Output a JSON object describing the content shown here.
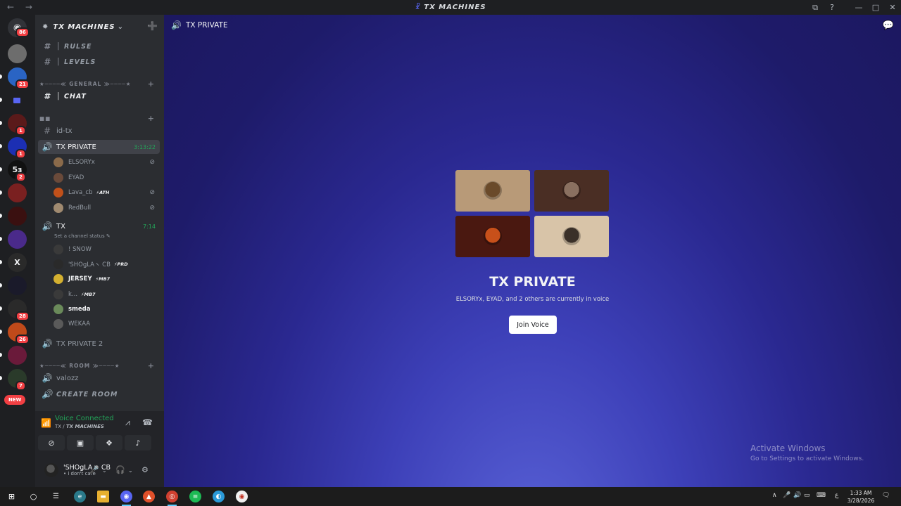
{
  "window": {
    "title": "TX MACHINES",
    "nav": "← →",
    "controls": [
      "⧉",
      "?",
      "—",
      "□",
      "✕"
    ]
  },
  "rail": {
    "home_badge": "86",
    "servers": [
      {
        "badge": "",
        "color": "#6d6d6d"
      },
      {
        "badge": "21",
        "color": "#2a64c4"
      },
      {
        "badge": "",
        "color": "#5865f2",
        "folder": true
      },
      {
        "badge": "1",
        "color": "#5a1a1a"
      },
      {
        "badge": "1",
        "color": "#1c2fb3"
      },
      {
        "badge": "2",
        "color": "#111111",
        "label": "5з"
      },
      {
        "badge": "",
        "color": "#7a2020"
      },
      {
        "badge": "",
        "color": "#3a1010"
      },
      {
        "badge": "",
        "color": "#4a2a8a"
      },
      {
        "badge": "",
        "color": "#2a2a2a",
        "label": "X"
      },
      {
        "badge": "",
        "color": "#1a1a2a"
      },
      {
        "badge": "28",
        "color": "#2a2a2a"
      },
      {
        "badge": "26",
        "color": "#c04a1a"
      },
      {
        "badge": "",
        "color": "#6a1a3a"
      },
      {
        "badge": "7",
        "color": "#2a3a2a"
      }
    ],
    "new_label": "NEW"
  },
  "sidebar": {
    "guild_name": "TX MACHINES",
    "channels": {
      "rulse": "│ RULSE",
      "levels": "│ LEVELS",
      "chat": "│ CHAT",
      "id_tx": "id-tx",
      "tx_private": "TX PRIVATE",
      "tx_private_time": "3:13:22",
      "tx": "TX",
      "tx_time": "7:14",
      "tx_status": "Set a channel status",
      "tx_private_2": "TX PRIVATE 2",
      "valozz": "valozz",
      "create_room": "CREATE ROOM"
    },
    "categories": {
      "general": "★────≪ GENERAL ≫────★",
      "unnamed": "■■",
      "room": "★────≪ ROOM ≫────★"
    },
    "private_members": [
      {
        "name": "ELSORYx",
        "tag": "",
        "color": "#8a6a4a"
      },
      {
        "name": "EYAD",
        "tag": "",
        "color": "#6a4a3a"
      },
      {
        "name": "Lava_cb",
        "tag": "ATH",
        "color": "#c0501a"
      },
      {
        "name": "RedBull",
        "tag": "",
        "color": "#a08a70"
      }
    ],
    "tx_members": [
      {
        "name": "! SNOW",
        "tag": "",
        "color": "#3a3a3a",
        "bold": false
      },
      {
        "name": "'SHOǥLAヽ CB",
        "tag": "PRD",
        "color": "#2a2a2a",
        "bold": false
      },
      {
        "name": "JERSEY",
        "tag": "MB7",
        "color": "#d4b030",
        "bold": true
      },
      {
        "name": "k...",
        "tag": "MB7",
        "color": "#3a3a3a",
        "bold": false
      },
      {
        "name": "smeda",
        "tag": "",
        "color": "#6a8a5a",
        "bold": true
      },
      {
        "name": "WEKAA",
        "tag": "",
        "color": "#5a5a5a",
        "bold": false
      }
    ]
  },
  "panel": {
    "voice_status": "Voice Connected",
    "voice_server": "TX MACHINES",
    "voice_channel": "TX",
    "username": "'SHOǥLAヽ CB",
    "user_status": "• i don't care"
  },
  "main": {
    "channel_name": "TX PRIVATE",
    "voice_title": "TX PRIVATE",
    "voice_desc": "ELSORYx, EYAD, and 2 others are currently in voice",
    "join_label": "Join Voice",
    "tiles": [
      {
        "bg": "#b89a78",
        "av": "#6a4a2a"
      },
      {
        "bg": "#4a2e24",
        "av": "#8a7060"
      },
      {
        "bg": "#4a1810",
        "av": "#c8501a"
      },
      {
        "bg": "#d8c4a8",
        "av": "#3a3028"
      }
    ],
    "watermark_title": "Activate Windows",
    "watermark_sub": "Go to Settings to activate Windows."
  },
  "taskbar": {
    "time": "1:33 AM",
    "date": "3/28/2026",
    "lang": "ع"
  }
}
